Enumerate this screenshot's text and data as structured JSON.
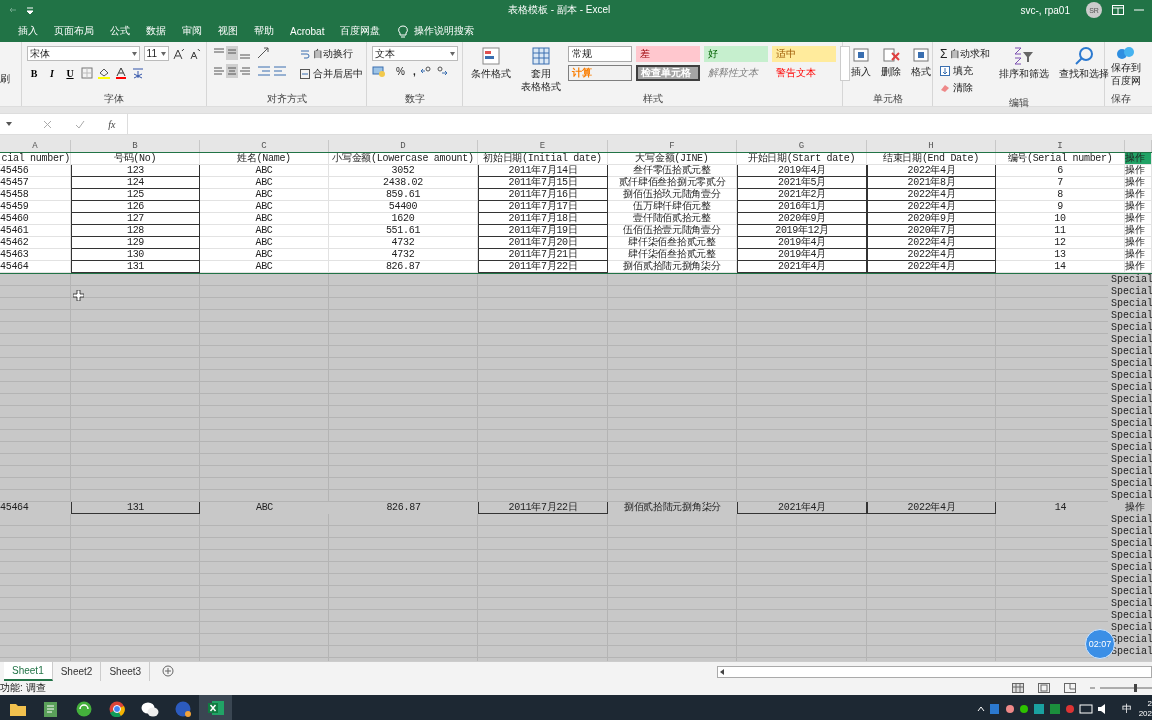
{
  "title_bar": {
    "title": "表格模板 - 副本 - Excel",
    "user": "svc-, rpa01",
    "avatar": "SR"
  },
  "menu_tabs": [
    {
      "label": "插入",
      "selected": false
    },
    {
      "label": "页面布局",
      "selected": false
    },
    {
      "label": "公式",
      "selected": false
    },
    {
      "label": "数据",
      "selected": false
    },
    {
      "label": "审阅",
      "selected": false
    },
    {
      "label": "视图",
      "selected": false
    },
    {
      "label": "帮助",
      "selected": false
    },
    {
      "label": "Acrobat",
      "selected": false
    },
    {
      "label": "百度网盘",
      "selected": false
    }
  ],
  "tell_me": "操作说明搜索",
  "ribbon": {
    "clipboard_tail": "刷",
    "font": {
      "name": "宋体",
      "size": "11",
      "format_buttons": [
        "B",
        "I",
        "U"
      ],
      "label": "字体"
    },
    "alignment": {
      "wrap": "自动换行",
      "merge": "合并后居中",
      "label": "对齐方式"
    },
    "number": {
      "format": "文本",
      "percent": "%",
      "comma": ",",
      "label": "数字"
    },
    "styles": {
      "conditional": "条件格式",
      "table": [
        "套用",
        "表格格式"
      ],
      "label": "样式",
      "cells": [
        {
          "label": "常规",
          "kind": "normal"
        },
        {
          "label": "差",
          "kind": "bad"
        },
        {
          "label": "好",
          "kind": "good"
        },
        {
          "label": "适中",
          "kind": "neutral"
        },
        {
          "label": "计算",
          "kind": "calc"
        },
        {
          "label": "检查单元格",
          "kind": "check"
        },
        {
          "label": "解释性文本",
          "kind": "explain"
        },
        {
          "label": "警告文本",
          "kind": "warn"
        }
      ]
    },
    "cells": {
      "buttons": [
        "插入",
        "删除",
        "格式"
      ],
      "label": "单元格"
    },
    "editing": {
      "sum_sign": "Σ",
      "autosum": "自动求和",
      "fill": "填充",
      "clear": "清除",
      "sort": "排序和筛选",
      "find": "查找和选择",
      "label": "编辑"
    },
    "save": {
      "lines": [
        "保存到",
        "百度网"
      ],
      "label": "保存"
    }
  },
  "formula_bar": {
    "fx": "fx"
  },
  "columns": [
    {
      "letter": "A",
      "boxed": false
    },
    {
      "letter": "B",
      "boxed": true
    },
    {
      "letter": "C",
      "boxed": false
    },
    {
      "letter": "D",
      "boxed": false
    },
    {
      "letter": "E",
      "boxed": true
    },
    {
      "letter": "F",
      "boxed": false
    },
    {
      "letter": "G",
      "boxed": true
    },
    {
      "letter": "H",
      "boxed": true
    },
    {
      "letter": "I",
      "boxed": false
    },
    {
      "boxed": false
    }
  ],
  "header_row": [
    "cial number)",
    "号码(No)",
    "姓名(Name)",
    "小写金额(Lowercase amount)",
    "初始日期(Initial date)",
    "大写金额(JINE)",
    "开始日期(Start date)",
    "结束日期(End Date)",
    "编号(Serial number)",
    "操作"
  ],
  "rows": [
    [
      "45456",
      "123",
      "ABC",
      "3052",
      "2011年7月14日",
      "叁仟零伍拾贰元整",
      "2019年4月",
      "2022年4月",
      "6",
      "操作"
    ],
    [
      "45457",
      "124",
      "ABC",
      "2438.02",
      "2011年7月15日",
      "贰仟肆佰叁拾捌元零贰分",
      "2021年5月",
      "2021年8月",
      "7",
      "操作"
    ],
    [
      "45458",
      "125",
      "ABC",
      "859.61",
      "2011年7月16日",
      "捌佰伍拾玖元陆角壹分",
      "2021年2月",
      "2022年4月",
      "8",
      "操作"
    ],
    [
      "45459",
      "126",
      "ABC",
      "54400",
      "2011年7月17日",
      "伍万肆仟肆佰元整",
      "2016年1月",
      "2022年4月",
      "9",
      "操作"
    ],
    [
      "45460",
      "127",
      "ABC",
      "1620",
      "2011年7月18日",
      "壹仟陆佰贰拾元整",
      "2020年9月",
      "2020年9月",
      "10",
      "操作"
    ],
    [
      "45461",
      "128",
      "ABC",
      "551.61",
      "2011年7月19日",
      "伍佰伍拾壹元陆角壹分",
      "2019年12月",
      "2020年7月",
      "11",
      "操作"
    ],
    [
      "45462",
      "129",
      "ABC",
      "4732",
      "2011年7月20日",
      "肆仟柒佰叁拾贰元整",
      "2019年4月",
      "2022年4月",
      "12",
      "操作"
    ],
    [
      "45463",
      "130",
      "ABC",
      "4732",
      "2011年7月21日",
      "肆仟柒佰叁拾贰元整",
      "2019年4月",
      "2022年4月",
      "13",
      "操作"
    ],
    [
      "45464",
      "131",
      "ABC",
      "826.87",
      "2011年7月22日",
      "捌佰贰拾陆元捌角柒分",
      "2021年4月",
      "2022年4月",
      "14",
      "操作"
    ]
  ],
  "drag_rows": [
    {
      "kind": "blank",
      "text": "Special"
    },
    {
      "kind": "blank",
      "text": "Special"
    },
    {
      "kind": "blank",
      "text": "Special"
    },
    {
      "kind": "blank",
      "text": "Special"
    },
    {
      "kind": "blank",
      "text": "Special"
    },
    {
      "kind": "blank",
      "text": "Special"
    },
    {
      "kind": "blank",
      "text": "Special"
    },
    {
      "kind": "blank",
      "text": "Special"
    },
    {
      "kind": "blank",
      "text": "Special"
    },
    {
      "kind": "blank",
      "text": "Special"
    },
    {
      "kind": "blank",
      "text": "Special"
    },
    {
      "kind": "blank",
      "text": "Special"
    },
    {
      "kind": "blank",
      "text": "Special"
    },
    {
      "kind": "blank",
      "text": "Special"
    },
    {
      "kind": "blank",
      "text": "Special"
    },
    {
      "kind": "blank",
      "text": "Special"
    },
    {
      "kind": "blank",
      "text": "Special"
    },
    {
      "kind": "blank",
      "text": "Special"
    },
    {
      "kind": "blank",
      "text": "Special"
    },
    {
      "kind": "copy",
      "cells": [
        "45464",
        "131",
        "ABC",
        "826.87",
        "2011年7月22日",
        "捌佰贰拾陆元捌角柒分",
        "2021年4月",
        "2022年4月",
        "14",
        "操作"
      ]
    },
    {
      "kind": "blank",
      "text": "Special"
    },
    {
      "kind": "blank",
      "text": "Special"
    },
    {
      "kind": "blank",
      "text": "Special"
    },
    {
      "kind": "blank",
      "text": "Special"
    },
    {
      "kind": "blank",
      "text": "Special"
    },
    {
      "kind": "blank",
      "text": "Special"
    },
    {
      "kind": "blank",
      "text": "Special"
    },
    {
      "kind": "blank",
      "text": "Special"
    },
    {
      "kind": "blank",
      "text": "Special"
    },
    {
      "kind": "blank",
      "text": "Special"
    },
    {
      "kind": "blank",
      "text": "Special"
    },
    {
      "kind": "blank",
      "text": "Special"
    }
  ],
  "timer": "02:07",
  "sheet_tabs": [
    {
      "label": "Sheet1",
      "selected": true
    },
    {
      "label": "Sheet2",
      "selected": false
    },
    {
      "label": "Sheet3",
      "selected": false
    }
  ],
  "status_bar": {
    "text": "功能: 调查"
  },
  "taskbar": {
    "apps": [
      {
        "kind": "explorer",
        "active": false
      },
      {
        "kind": "notes",
        "active": false
      },
      {
        "kind": "sync",
        "active": false
      },
      {
        "kind": "chrome",
        "active": false
      },
      {
        "kind": "wechat",
        "active": false
      },
      {
        "kind": "ub",
        "active": false
      },
      {
        "kind": "excel",
        "active": true
      }
    ],
    "ime": "中",
    "time": "2",
    "date": "202"
  }
}
